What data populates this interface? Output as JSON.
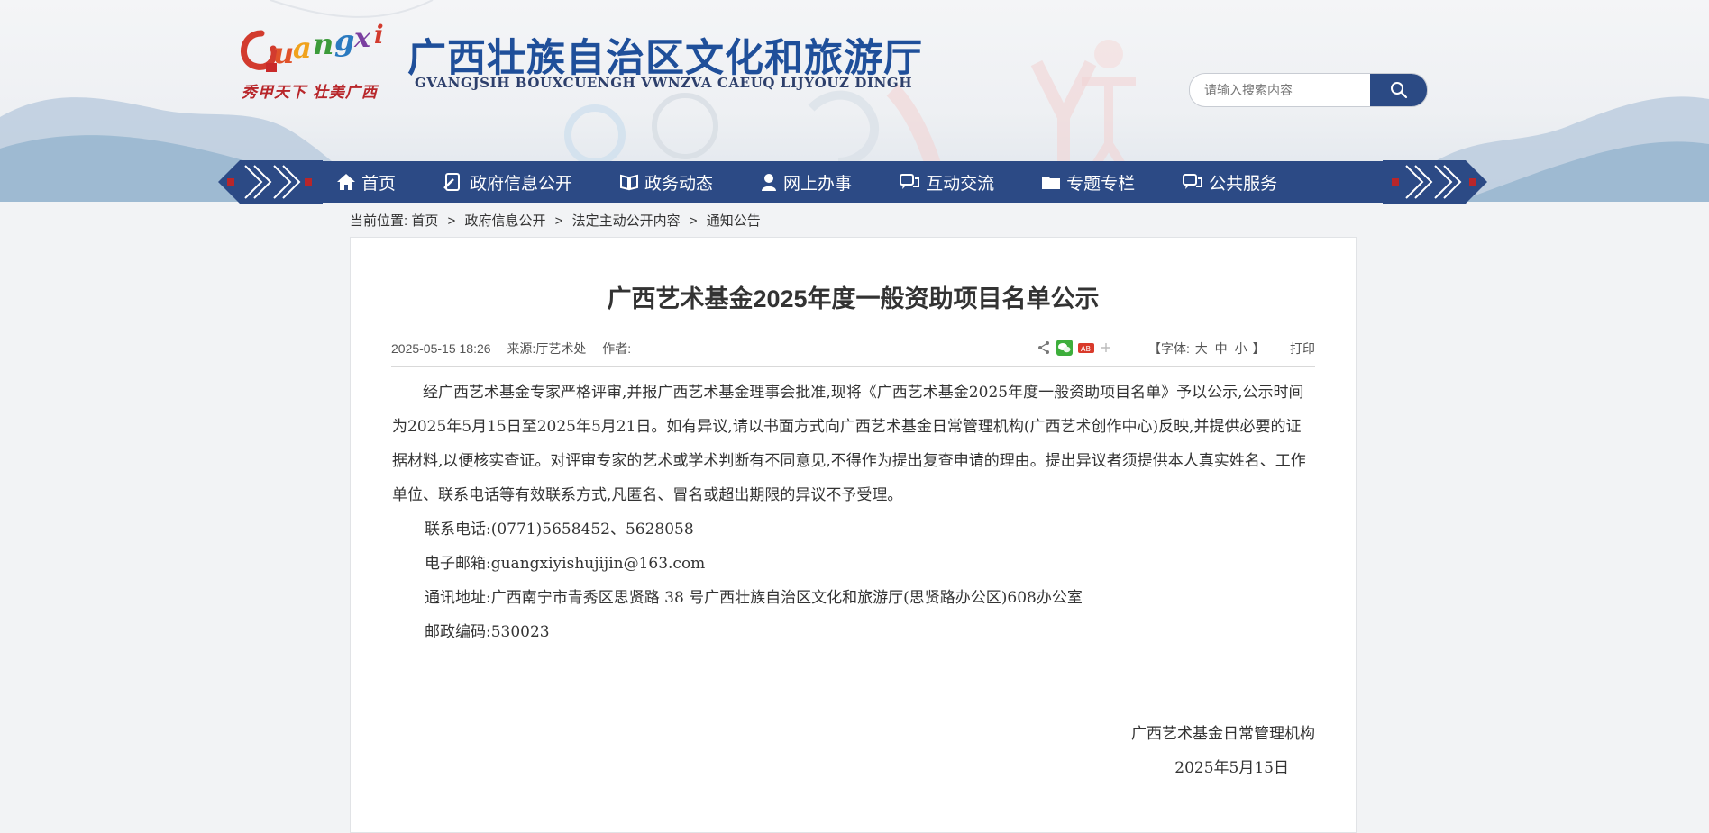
{
  "header": {
    "site_title": "广西壮族自治区文化和旅游厅",
    "site_subtitle": "GVANGJSIH BOUXCUENGH VWNZVA CAEUQ LIJYOUZ DINGH",
    "logo_text": "Guangxi",
    "slogan": "秀甲天下 壮美广西",
    "search_placeholder": "请输入搜索内容"
  },
  "nav": {
    "items": [
      {
        "label": "首页",
        "icon": "home-icon"
      },
      {
        "label": "政府信息公开",
        "icon": "document-pen-icon"
      },
      {
        "label": "政务动态",
        "icon": "open-book-icon"
      },
      {
        "label": "网上办事",
        "icon": "person-icon"
      },
      {
        "label": "互动交流",
        "icon": "chat-bubbles-icon"
      },
      {
        "label": "专题专栏",
        "icon": "folder-icon"
      },
      {
        "label": "公共服务",
        "icon": "chat-bubbles-icon"
      }
    ]
  },
  "breadcrumb": {
    "prefix": "当前位置:",
    "items": [
      "首页",
      "政府信息公开",
      "法定主动公开内容",
      "通知公告"
    ],
    "separator": ">"
  },
  "article": {
    "title": "广西艺术基金2025年度一般资助项目名单公示",
    "datetime": "2025-05-15 18:26",
    "source": "来源:厅艺术处",
    "author": "作者:",
    "font_label_open": "【字体:",
    "font_sizes": [
      "大",
      "中",
      "小"
    ],
    "font_label_close": "】",
    "print_label": "打印",
    "body": "经广西艺术基金专家严格评审,并报广西艺术基金理事会批准,现将《广西艺术基金2025年度一般资助项目名单》予以公示,公示时间为2025年5月15日至2025年5月21日。如有异议,请以书面方式向广西艺术基金日常管理机构(广西艺术创作中心)反映,并提供必要的证据材料,以便核实查证。对评审专家的艺术或学术判断有不同意见,不得作为提出复查申请的理由。提出异议者须提供本人真实姓名、工作单位、联系电话等有效联系方式,凡匿名、冒名或超出期限的异议不予受理。",
    "phone": "联系电话:(0771)5658452、5628058",
    "email": "电子邮箱:guangxiyishujijin@163.com",
    "address": "通讯地址:广西南宁市青秀区思贤路 38 号广西壮族自治区文化和旅游厅(思贤路办公区)608办公室",
    "postcode": "邮政编码:530023",
    "signature_org": "广西艺术基金日常管理机构",
    "signature_date": "2025年5月15日"
  },
  "colors": {
    "nav_bg": "#2c4a85",
    "title_blue": "#1f4f9a",
    "slogan_red": "#b8262a",
    "page_bg": "#f2f3f5"
  }
}
